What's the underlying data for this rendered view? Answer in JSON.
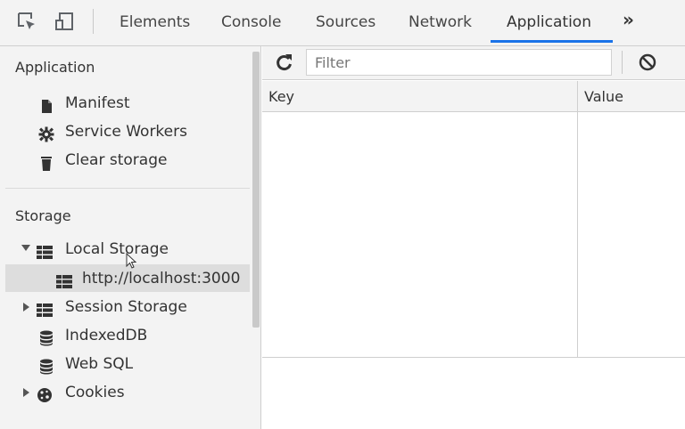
{
  "toolbar": {
    "inspect_icon": "inspect-element-icon",
    "device_icon": "device-toolbar-icon",
    "more_label": "»"
  },
  "tabs": [
    {
      "label": "Elements",
      "active": false
    },
    {
      "label": "Console",
      "active": false
    },
    {
      "label": "Sources",
      "active": false
    },
    {
      "label": "Network",
      "active": false
    },
    {
      "label": "Application",
      "active": true
    }
  ],
  "sidebar": {
    "application_section": "Application",
    "application_items": [
      {
        "label": "Manifest",
        "icon": "document-icon"
      },
      {
        "label": "Service Workers",
        "icon": "gear-icon"
      },
      {
        "label": "Clear storage",
        "icon": "trash-icon"
      }
    ],
    "storage_section": "Storage",
    "storage_items": [
      {
        "label": "Local Storage",
        "icon": "grid-icon",
        "expanded": true
      },
      {
        "label": "http://localhost:3000",
        "icon": "grid-icon",
        "selected": true
      },
      {
        "label": "Session Storage",
        "icon": "grid-icon",
        "expanded": false
      },
      {
        "label": "IndexedDB",
        "icon": "database-icon"
      },
      {
        "label": "Web SQL",
        "icon": "database-icon"
      },
      {
        "label": "Cookies",
        "icon": "cookie-icon",
        "expanded": false
      }
    ]
  },
  "main": {
    "filter_placeholder": "Filter",
    "columns": [
      "Key",
      "Value"
    ]
  },
  "colors": {
    "accent": "#1a73e8",
    "panel_bg": "#f3f3f3",
    "selected_bg": "#dddddd"
  }
}
